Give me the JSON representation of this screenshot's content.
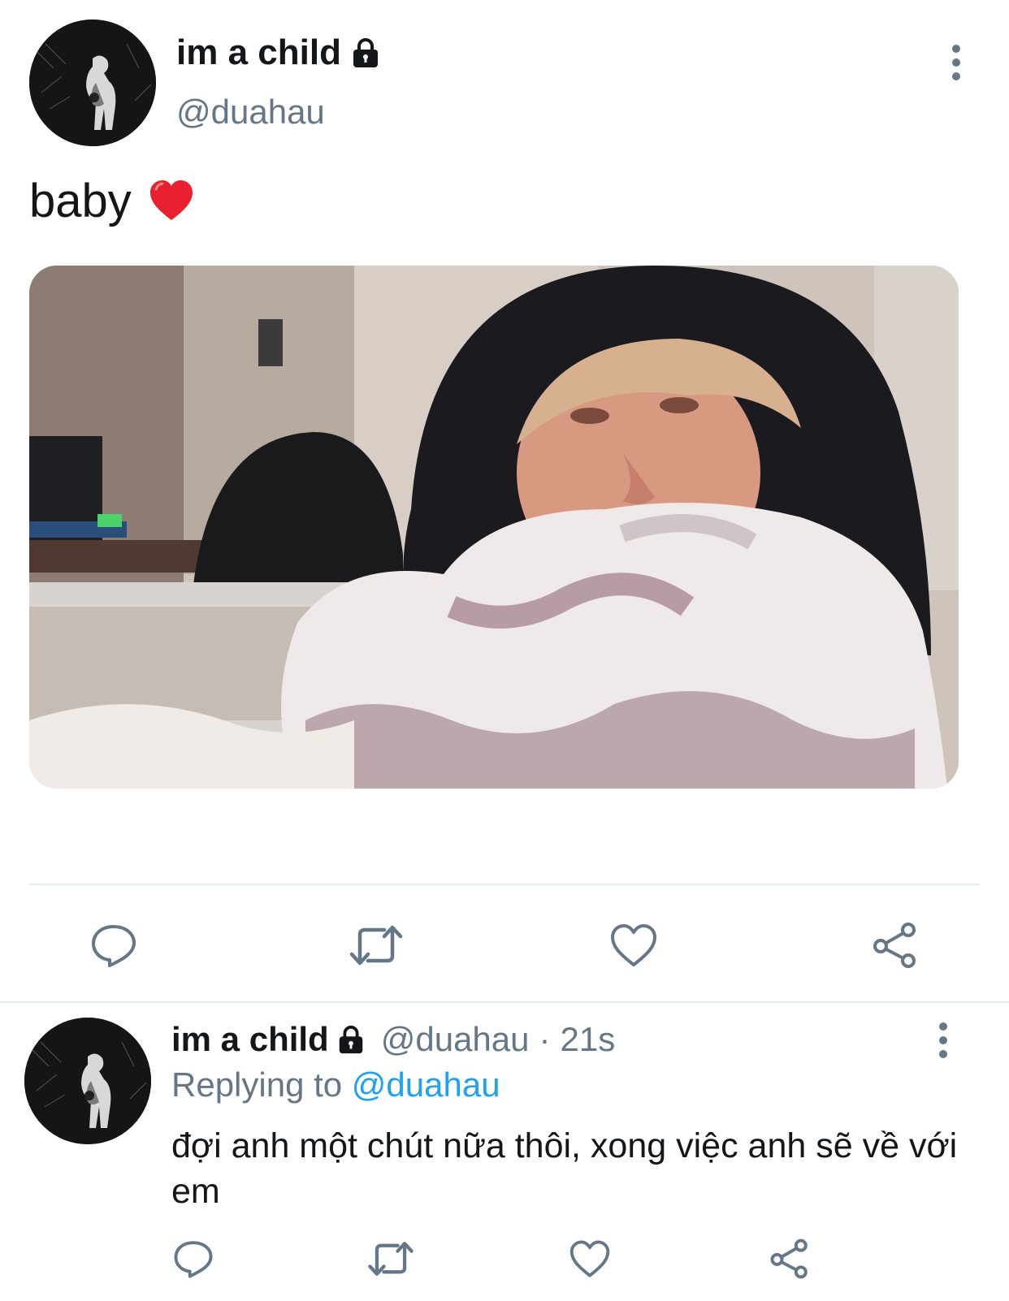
{
  "main_tweet": {
    "display_name": "im a child",
    "handle": "@duahau",
    "text": "baby",
    "emoji": "red-heart",
    "icons": [
      "lock-icon",
      "more-vertical-icon"
    ],
    "media": "photo",
    "actions": [
      "reply-icon",
      "retweet-icon",
      "like-icon",
      "share-icon"
    ]
  },
  "reply_tweet": {
    "display_name": "im a child",
    "handle": "@duahau",
    "separator": "·",
    "time": "21s",
    "replying_prefix": "Replying to",
    "replying_to": "@duahau",
    "text": "đợi anh một chút nữa thôi, xong việc anh sẽ về với em",
    "actions": [
      "reply-icon",
      "retweet-icon",
      "like-icon",
      "share-icon"
    ]
  },
  "colors": {
    "text": "#14171a",
    "secondary": "#657786",
    "link": "#1da1f2",
    "divider": "#e6ecf0",
    "heart": "#e0245e"
  }
}
